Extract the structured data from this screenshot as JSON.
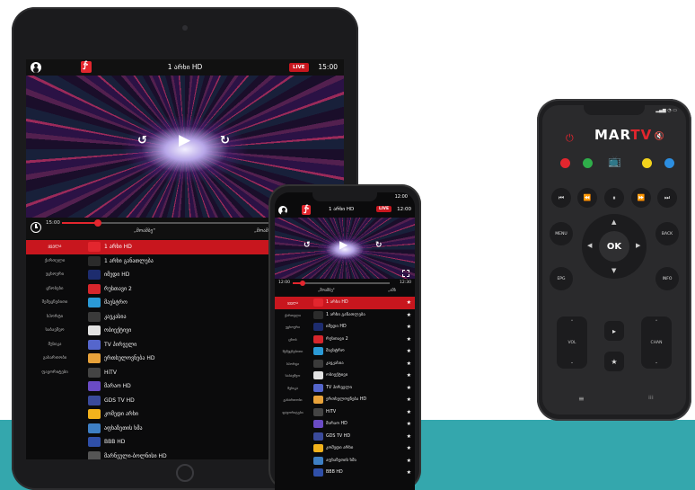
{
  "colors": {
    "accent": "#c8161e",
    "brand_red": "#e3262e",
    "teal_band": "#34a7ad"
  },
  "tablet": {
    "channel_title": "1 არხი HD",
    "live_label": "LIVE",
    "clock": "15:00",
    "progress_start": "15:00",
    "program_current": "„მოამბე\"",
    "program_next": "„მოამბე\"",
    "progress_fraction": 0.13,
    "categories": [
      "ყველა",
      "ქართული",
      "უცხოური",
      "ცნობები",
      "შემეცნებითი",
      "სპორტი",
      "საბავშვო",
      "მუსიკა",
      "გასართობი",
      "ფავორიტები"
    ],
    "channels": [
      {
        "name": "1 არხი HD",
        "logo_color": "#e3262e"
      },
      {
        "name": "1 არხი განათლება",
        "logo_color": "#2b2b2b"
      },
      {
        "name": "იმედი HD",
        "logo_color": "#1d2c6e"
      },
      {
        "name": "რუსთავი 2",
        "logo_color": "#d7262c"
      },
      {
        "name": "მაესტრო",
        "logo_color": "#2b9ad6"
      },
      {
        "name": "კავკასია",
        "logo_color": "#3a3a3a"
      },
      {
        "name": "ობიექტივი",
        "logo_color": "#e2e2e2"
      },
      {
        "name": "TV პირველი",
        "logo_color": "#5566cc"
      },
      {
        "name": "ერთსულოვნება HD",
        "logo_color": "#e8a23a"
      },
      {
        "name": "HiTV",
        "logo_color": "#444444"
      },
      {
        "name": "მარაო HD",
        "logo_color": "#6a4bc4"
      },
      {
        "name": "GDS TV HD",
        "logo_color": "#3a4a9a"
      },
      {
        "name": "კომედი არხი",
        "logo_color": "#f2b21c"
      },
      {
        "name": "აფხაზეთის ხმა",
        "logo_color": "#3e7fc4"
      },
      {
        "name": "BBB HD",
        "logo_color": "#2f4fa8"
      },
      {
        "name": "მარნეული-ბოლნისი HD",
        "logo_color": "#555555"
      }
    ]
  },
  "phone": {
    "status_time": "12:00",
    "channel_title": "1 არხი HD",
    "live_label": "LIVE",
    "clock": "12:00",
    "progress_start": "12:00",
    "progress_end": "12:30",
    "program_current": "„მოამბე\"",
    "program_next": "„ამბ",
    "progress_fraction": 0.1,
    "star_icon": "★",
    "categories": [
      "ყველა",
      "ქართული",
      "უცხოური",
      "ცნობ",
      "შემეცნებითი",
      "სპორტი",
      "საბავშვო",
      "მუსიკა",
      "გასართობი",
      "ფავორიტები"
    ],
    "channels": [
      {
        "name": "1 არხი HD",
        "logo_color": "#e3262e"
      },
      {
        "name": "1 არხი განათლება",
        "logo_color": "#2b2b2b"
      },
      {
        "name": "იმედი HD",
        "logo_color": "#1d2c6e"
      },
      {
        "name": "რუსთავი 2",
        "logo_color": "#d7262c"
      },
      {
        "name": "მაესტრო",
        "logo_color": "#2b9ad6"
      },
      {
        "name": "კავკასია",
        "logo_color": "#3a3a3a"
      },
      {
        "name": "ობიექტივი",
        "logo_color": "#e2e2e2"
      },
      {
        "name": "TV პირველი",
        "logo_color": "#5566cc"
      },
      {
        "name": "ერთსულოვნება HD",
        "logo_color": "#e8a23a"
      },
      {
        "name": "HiTV",
        "logo_color": "#444444"
      },
      {
        "name": "მარაო HD",
        "logo_color": "#6a4bc4"
      },
      {
        "name": "GDS TV HD",
        "logo_color": "#3a4a9a"
      },
      {
        "name": "კომედი არხი",
        "logo_color": "#f2b21c"
      },
      {
        "name": "აფხაზეთის ხმა",
        "logo_color": "#3e7fc4"
      },
      {
        "name": "BBB HD",
        "logo_color": "#2f4fa8"
      }
    ]
  },
  "remote": {
    "brand_prefix": "MAR",
    "brand_suffix": "TV",
    "power_icon": "⏻",
    "mute_icon": "🔇",
    "tv_off_icon": "📺",
    "color_keys": [
      "#e3262e",
      "#2fae4a",
      "#f2d21c",
      "#2c8ee0"
    ],
    "media": [
      "⏮",
      "⏪",
      "⏸",
      "⏩",
      "⏭"
    ],
    "menu_label": "MENU",
    "back_label": "BACK",
    "epg_label": "EPG",
    "info_label": "INFO",
    "ok_label": "OK",
    "vol_label": "VOL",
    "chan_label": "CHAN",
    "play_icon": "▸",
    "star_icon": "★",
    "up_icon": "⌃",
    "down_icon": "⌄",
    "menu_icon": "≡",
    "grid_icon": "⁞⁞⁞"
  }
}
